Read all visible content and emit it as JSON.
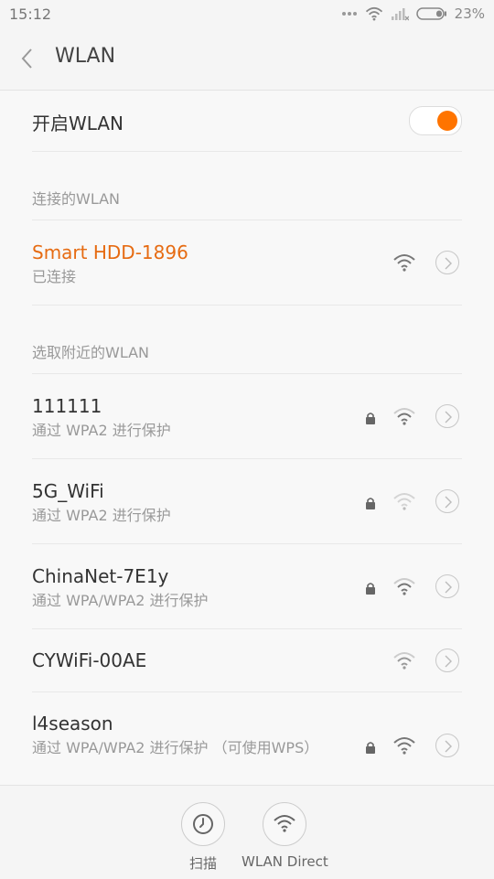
{
  "status_bar": {
    "time": "15:12",
    "battery": "23%"
  },
  "header": {
    "title": "WLAN"
  },
  "toggle": {
    "label": "开启WLAN",
    "on": true
  },
  "sections": {
    "connected": "连接的WLAN",
    "nearby": "选取附近的WLAN"
  },
  "connected_network": {
    "name": "Smart HDD-1896",
    "status": "已连接"
  },
  "networks": [
    {
      "name": "111111",
      "security": "通过 WPA2 进行保护"
    },
    {
      "name": "5G_WiFi",
      "security": "通过 WPA2 进行保护"
    },
    {
      "name": "ChinaNet-7E1y",
      "security": "通过 WPA/WPA2 进行保护"
    },
    {
      "name": "CYWiFi-00AE",
      "security": ""
    },
    {
      "name": "l4season",
      "security": "通过 WPA/WPA2 进行保护 （可使用WPS）"
    }
  ],
  "bottom_bar": {
    "scan_label": "扫描",
    "direct_label": "WLAN Direct"
  },
  "colors": {
    "accent": "#ff7400",
    "connected_text": "#e66b12"
  }
}
